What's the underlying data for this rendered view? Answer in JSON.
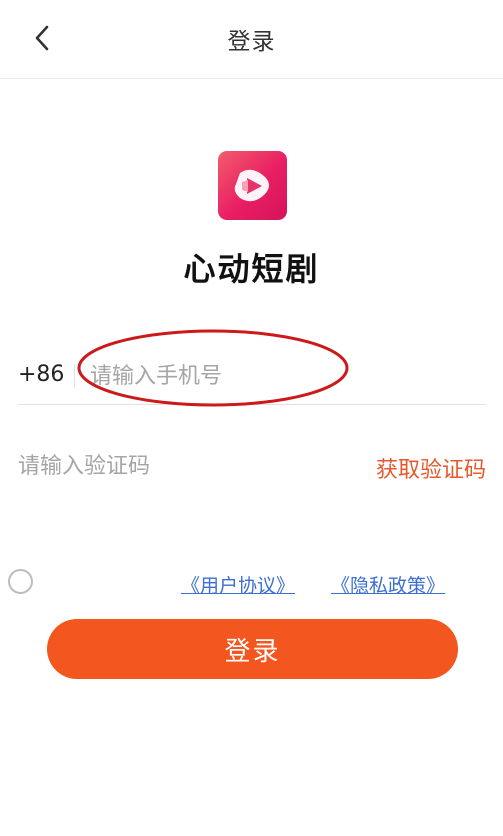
{
  "header": {
    "title": "登录",
    "back_icon": "chevron-left-icon"
  },
  "app": {
    "name": "心动短剧",
    "logo_icon": "play-logo-icon"
  },
  "phone": {
    "country_code": "+86",
    "placeholder": "请输入手机号",
    "value": ""
  },
  "code": {
    "placeholder": "请输入验证码",
    "value": "",
    "get_code_label": "获取验证码"
  },
  "agreement": {
    "checked": false,
    "user_agreement": "《用户协议》",
    "privacy_policy": "《隐私政策》"
  },
  "login_button": "登录",
  "colors": {
    "accent": "#f4561f",
    "get_code": "#e8582c",
    "link": "#3d6fd1",
    "annotation": "#cc1a1a"
  }
}
